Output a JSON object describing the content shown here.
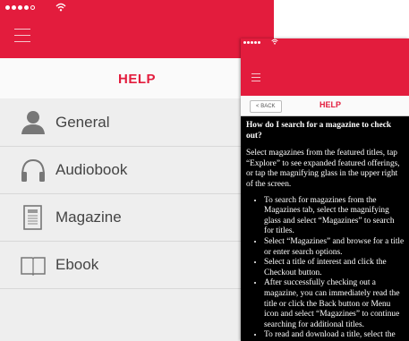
{
  "left_screen": {
    "title": "HELP",
    "items": [
      {
        "label": "General",
        "icon": "person-icon"
      },
      {
        "label": "Audiobook",
        "icon": "headphones-icon"
      },
      {
        "label": "Magazine",
        "icon": "magazine-icon"
      },
      {
        "label": "Ebook",
        "icon": "book-icon"
      }
    ]
  },
  "right_screen": {
    "back_label": "BACK",
    "title": "HELP",
    "question": "How do I search for a magazine to check out?",
    "intro": "Select magazines from the featured titles, tap “Explore” to see expanded featured offerings, or tap the magnifying glass in the upper right of the screen.",
    "bullets": [
      "To search for magazines from the Magazines tab, select the magnifying glass and select “Magazines” to search for titles.",
      "Select “Magazines” and browse for a title or enter search options.",
      "Select a title of interest and click the Checkout button.",
      "After successfully checking out a magazine, you can immediately read the title or click the Back button or Menu icon and select “Magazines” to continue searching for additional titles.",
      "To read and download a title, select the Read link or click the Read button."
    ]
  },
  "colors": {
    "brand_red": "#e31c3d"
  }
}
